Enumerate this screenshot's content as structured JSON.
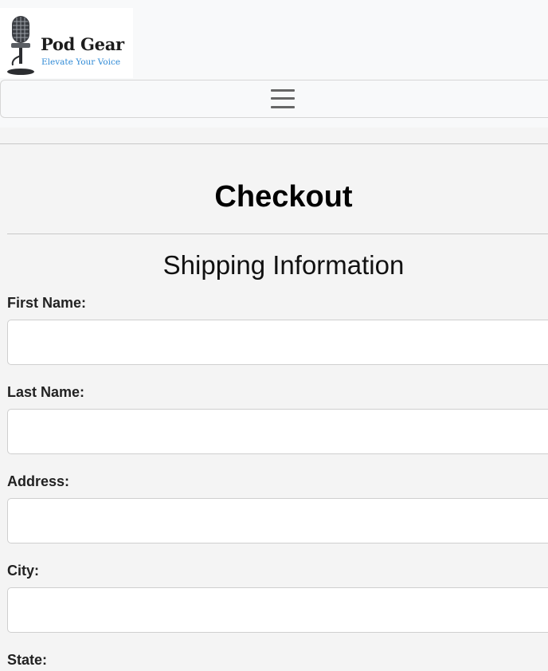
{
  "brand": {
    "name": "Pod Gear",
    "tagline": "Elevate Your Voice",
    "tagline_color": "#2f8ad6"
  },
  "navbar": {
    "toggler_icon": "hamburger-menu-icon"
  },
  "page": {
    "title": "Checkout",
    "section_title": "Shipping Information"
  },
  "form": {
    "fields": [
      {
        "label": "First Name:",
        "value": "",
        "placeholder": ""
      },
      {
        "label": "Last Name:",
        "value": "",
        "placeholder": ""
      },
      {
        "label": "Address:",
        "value": "",
        "placeholder": ""
      },
      {
        "label": "City:",
        "value": "",
        "placeholder": ""
      },
      {
        "label": "State:",
        "value": "",
        "placeholder": ""
      }
    ]
  }
}
